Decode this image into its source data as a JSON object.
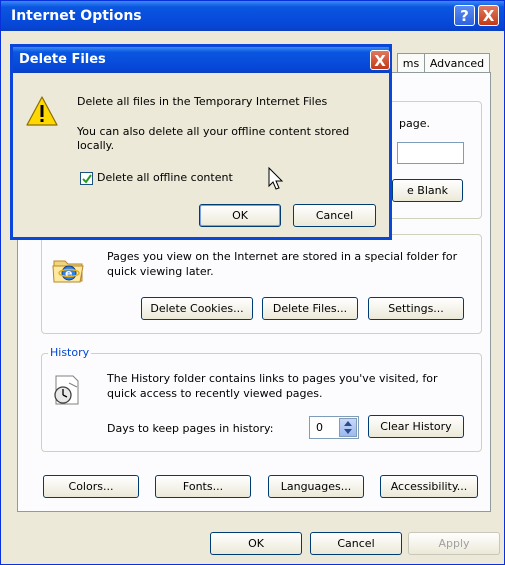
{
  "window": {
    "title": "Internet Options",
    "help_symbol": "?",
    "close_symbol": "X",
    "tabs": [
      "ms",
      "Advanced"
    ]
  },
  "home_page": {
    "partial_text": "page.",
    "use_blank_label": "e Blank"
  },
  "temp_files": {
    "description": "Pages you view on the Internet are stored in a special folder for quick viewing later.",
    "delete_cookies_label": "Delete Cookies...",
    "delete_files_label": "Delete Files...",
    "settings_label": "Settings..."
  },
  "history": {
    "group_label": "History",
    "description": "The History folder contains links to pages you've visited, for quick access to recently viewed pages.",
    "days_label": "Days to keep pages in history:",
    "days_value": "0",
    "clear_label": "Clear History"
  },
  "bottom_buttons": {
    "colors": "Colors...",
    "fonts": "Fonts...",
    "languages": "Languages...",
    "accessibility": "Accessibility..."
  },
  "footer": {
    "ok": "OK",
    "cancel": "Cancel",
    "apply": "Apply"
  },
  "dialog": {
    "title": "Delete Files",
    "close_symbol": "X",
    "message_line1": "Delete all files in the Temporary Internet Files",
    "message_line2": "You can also delete all your offline content stored locally.",
    "checkbox_label": "Delete all offline content",
    "checkbox_checked": true,
    "ok": "OK",
    "cancel": "Cancel"
  },
  "colors": {
    "title_bar": "#0a56e0",
    "group_label": "#0046d5",
    "dialog_bg": "#ece9d8",
    "close_button": "#c23a18"
  }
}
